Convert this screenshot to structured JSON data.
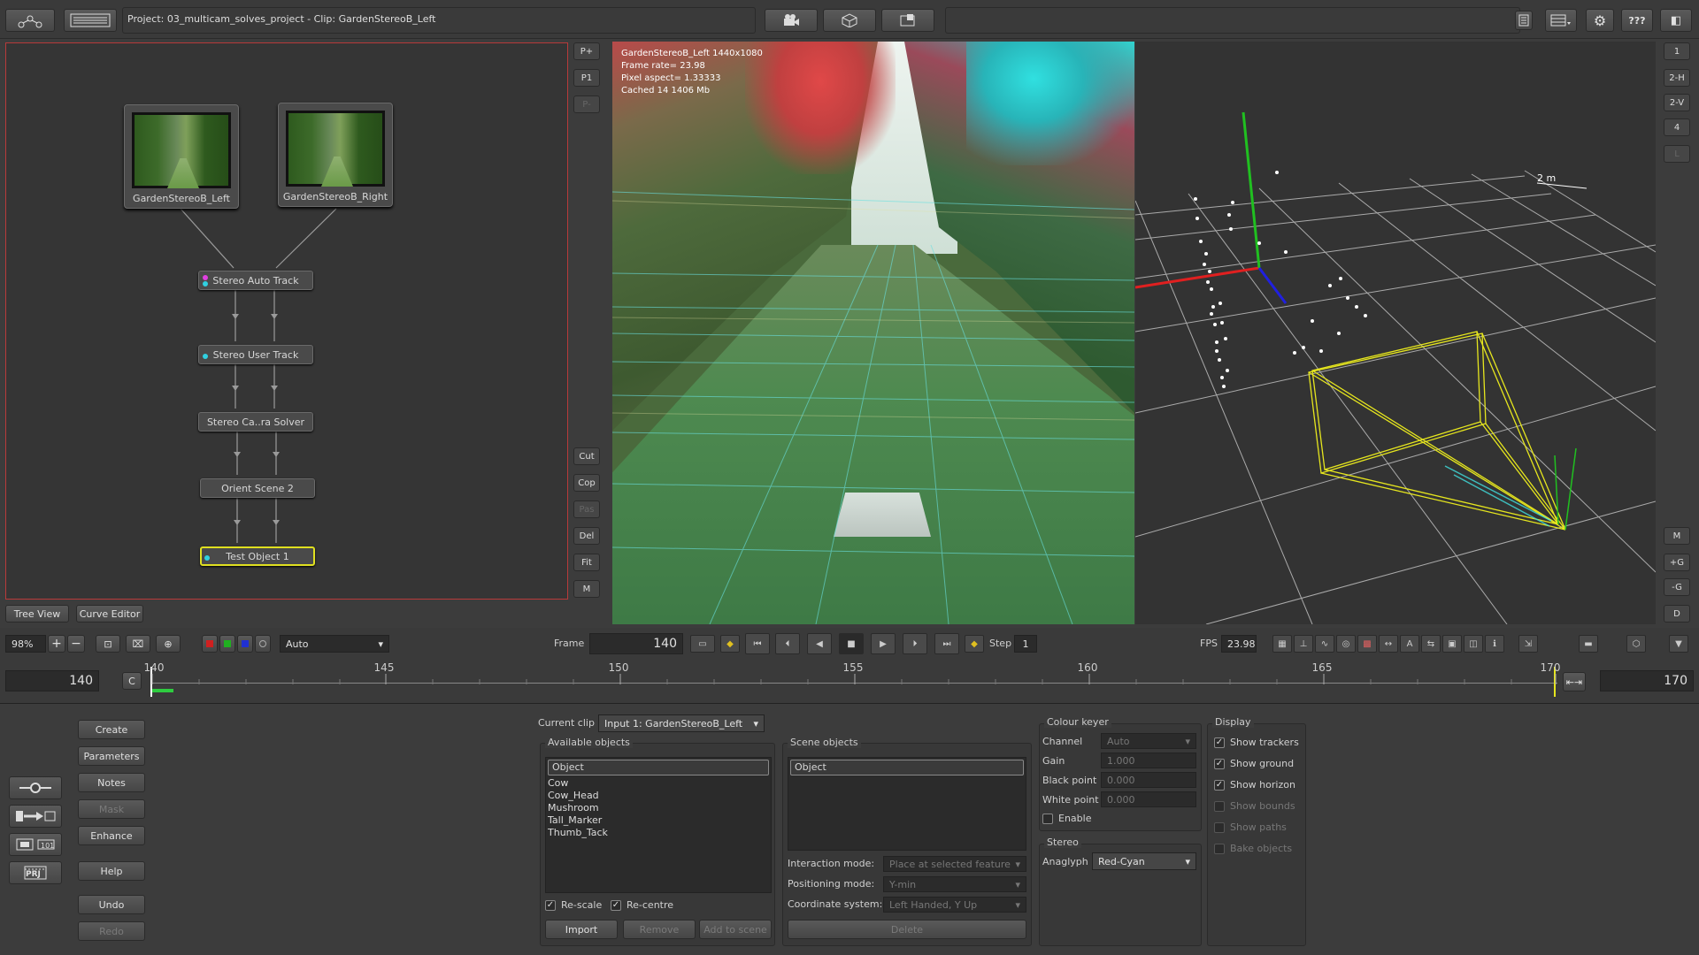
{
  "header": {
    "project_title": "Project: 03_multicam_solves_project - Clip: GardenStereoB_Left",
    "help_label": "???"
  },
  "nodes": {
    "thumb_left": "GardenStereoB_Left",
    "thumb_right": "GardenStereoB_Right",
    "items": [
      "Stereo Auto Track",
      "Stereo User Track",
      "Stereo Ca..ra Solver",
      "Orient Scene 2",
      "Test Object 1"
    ]
  },
  "tree_tabs": {
    "tree_view": "Tree View",
    "curve_editor": "Curve Editor"
  },
  "viewer_side": {
    "p_plus": "P+",
    "p1": "P1",
    "p_minus": "P-",
    "cut": "Cut",
    "cop": "Cop",
    "pas": "Pas",
    "del": "Del",
    "fit": "Fit",
    "m": "M"
  },
  "viewer_overlay": {
    "line1": "GardenStereoB_Left 1440x1080",
    "line2": "Frame rate= 23.98",
    "line3": "Pixel aspect= 1.33333",
    "line4": "Cached 14 1406 Mb"
  },
  "view3d": {
    "scale_label": "2 m"
  },
  "right_side": {
    "b1": "1",
    "b2h": "2-H",
    "b2v": "2-V",
    "b4": "4",
    "bl": "L",
    "bm": "M",
    "bplus_g": "+G",
    "bminus_g": "-G",
    "bd": "D"
  },
  "controls": {
    "zoom": "98%",
    "display_mode": "Auto",
    "frame_label": "Frame",
    "frame_value": "140",
    "step_label": "Step",
    "step_value": "1",
    "fps_label": "FPS",
    "fps_value": "23.98"
  },
  "timeline": {
    "start_frame": "140",
    "c_button": "C",
    "end_frame": "170",
    "ticks": [
      "140",
      "145",
      "150",
      "155",
      "160",
      "165",
      "170"
    ]
  },
  "left_tools": {
    "create": "Create",
    "parameters": "Parameters",
    "notes": "Notes",
    "mask": "Mask",
    "enhance": "Enhance",
    "help": "Help",
    "undo": "Undo",
    "redo": "Redo",
    "prj_icon": "PRJ"
  },
  "objects": {
    "current_clip_label": "Current clip",
    "current_clip_value": "Input 1: GardenStereoB_Left",
    "available_label": "Available objects",
    "available_header": "Object",
    "available_items": [
      "Cow",
      "Cow_Head",
      "Mushroom",
      "Tall_Marker",
      "Thumb_Tack"
    ],
    "rescale": "Re-scale",
    "recentre": "Re-centre",
    "import": "Import",
    "remove": "Remove",
    "add_to_scene": "Add to scene",
    "scene_label": "Scene objects",
    "scene_header": "Object",
    "interaction_label": "Interaction mode:",
    "interaction_value": "Place at selected feature",
    "positioning_label": "Positioning mode:",
    "positioning_value": "Y-min",
    "coord_label": "Coordinate system:",
    "coord_value": "Left Handed, Y Up",
    "delete": "Delete"
  },
  "colour_keyer": {
    "title": "Colour keyer",
    "channel_label": "Channel",
    "channel_value": "Auto",
    "gain_label": "Gain",
    "gain_value": "1.000",
    "black_label": "Black point",
    "black_value": "0.000",
    "white_label": "White point",
    "white_value": "0.000",
    "enable": "Enable"
  },
  "stereo": {
    "title": "Stereo",
    "anaglyph_label": "Anaglyph",
    "anaglyph_value": "Red-Cyan"
  },
  "display": {
    "title": "Display",
    "show_trackers": "Show trackers",
    "show_ground": "Show ground",
    "show_horizon": "Show horizon",
    "show_bounds": "Show bounds",
    "show_paths": "Show paths",
    "bake_objects": "Bake objects"
  },
  "colors": {
    "accent_red": "#c83232",
    "selection_yellow": "#e6e61e",
    "timeline_green": "#2ecc40",
    "background": "#3c3c3c"
  }
}
